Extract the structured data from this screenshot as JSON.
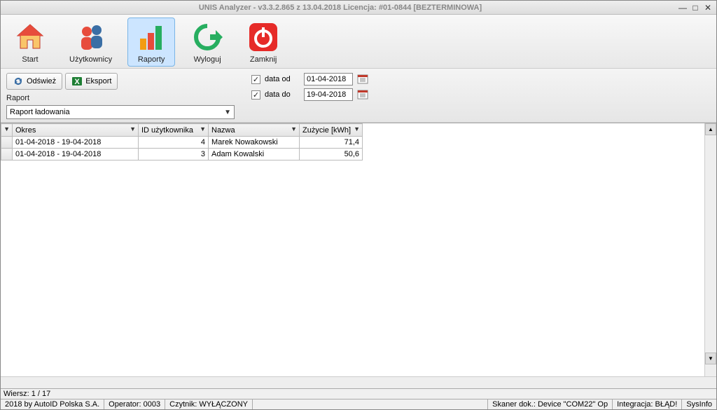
{
  "title": "UNIS Analyzer - v3.3.2.865 z 13.04.2018     Licencja: #01-0844 [BEZTERMINOWA]",
  "toolbar": {
    "start": "Start",
    "users": "Użytkownicy",
    "reports": "Raporty",
    "logout": "Wyloguj",
    "close": "Zamknij"
  },
  "filter": {
    "refresh": "Odśwież",
    "export": "Eksport",
    "raport_label": "Raport",
    "raport_value": "Raport ładowania",
    "date_from_label": "data od",
    "date_from_value": "01-04-2018",
    "date_to_label": "data do",
    "date_to_value": "19-04-2018",
    "check": "✓"
  },
  "grid": {
    "headers": {
      "okres": "Okres",
      "id": "ID użytkownika",
      "nazwa": "Nazwa",
      "zuzycie": "Zużycie [kWh]"
    },
    "rows": [
      {
        "okres": "01-04-2018  -  19-04-2018",
        "id": "4",
        "nazwa": "Marek Nowakowski",
        "zuzycie": "71,4"
      },
      {
        "okres": "01-04-2018  -  19-04-2018",
        "id": "3",
        "nazwa": "Adam Kowalski",
        "zuzycie": "50,6"
      }
    ]
  },
  "status1": "Wiersz: 1 / 17",
  "status2": {
    "copyright": "2018 by AutoID Polska S.A.",
    "operator": "Operator: 0003",
    "reader": "Czytnik: WYŁĄCZONY",
    "scanner": "Skaner dok.: Device \"COM22\" Op",
    "integration": "Integracja: BŁĄD!",
    "sysinfo": "SysInfo"
  }
}
